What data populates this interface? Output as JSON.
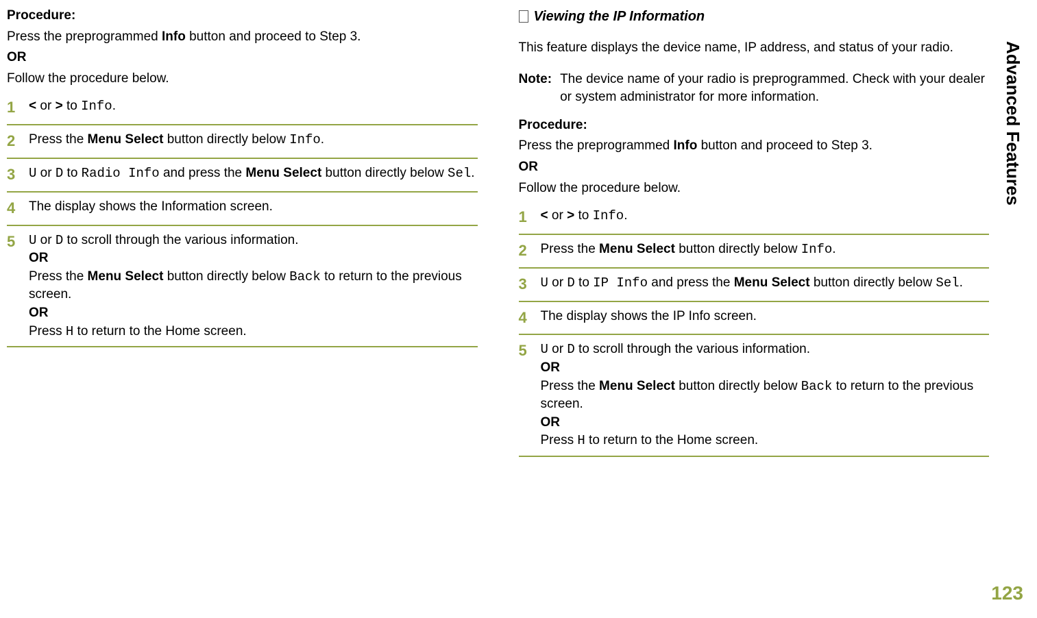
{
  "side_label": "Advanced Features",
  "page_number": "123",
  "left": {
    "procedure_label": "Procedure:",
    "intro_l1a": "Press the preprogrammed ",
    "intro_l1b": "Info",
    "intro_l1c": " button and proceed to Step 3.",
    "or": "OR",
    "intro_l2": "Follow the procedure below.",
    "s1_a": "<",
    "s1_b": " or ",
    "s1_c": ">",
    "s1_d": " to ",
    "s1_e": "Info",
    "s1_f": ".",
    "s2_a": "Press the ",
    "s2_b": "Menu Select",
    "s2_c": " button directly below ",
    "s2_d": "Info",
    "s2_e": ".",
    "s3_a": "U",
    "s3_b": " or ",
    "s3_c": "D",
    "s3_d": " to ",
    "s3_e": "Radio Info",
    "s3_f": " and press the ",
    "s3_g": "Menu Select",
    "s3_h": " button directly below ",
    "s3_i": "Sel",
    "s3_j": ".",
    "s4": "The display shows the Information screen.",
    "s5_a": "U",
    "s5_b": " or ",
    "s5_c": "D",
    "s5_d": " to scroll through the various information.",
    "s5_or": "OR",
    "s5_e": "Press the ",
    "s5_f": "Menu Select",
    "s5_g": " button directly below ",
    "s5_h": "Back",
    "s5_i": " to return to the previous screen.",
    "s5_or2": "OR",
    "s5_j": "Press ",
    "s5_k": "H",
    "s5_l": " to return to the Home screen."
  },
  "right": {
    "heading": "Viewing the IP Information",
    "intro": "This feature displays the device name, IP address, and status of your radio.",
    "note_label": "Note:",
    "note_body": "The device name of your radio is preprogrammed. Check with your dealer or system administrator for more information.",
    "procedure_label": "Procedure:",
    "intro_l1a": "Press the preprogrammed ",
    "intro_l1b": "Info",
    "intro_l1c": " button and proceed to Step 3.",
    "or": "OR",
    "intro_l2": "Follow the procedure below.",
    "s1_a": "<",
    "s1_b": " or ",
    "s1_c": ">",
    "s1_d": " to ",
    "s1_e": "Info",
    "s1_f": ".",
    "s2_a": "Press the ",
    "s2_b": "Menu Select",
    "s2_c": " button directly below ",
    "s2_d": "Info",
    "s2_e": ".",
    "s3_a": "U",
    "s3_b": " or ",
    "s3_c": "D",
    "s3_d": " to ",
    "s3_e": "IP Info",
    "s3_f": " and press the ",
    "s3_g": "Menu Select",
    "s3_h": " button directly below ",
    "s3_i": "Sel",
    "s3_j": ".",
    "s4": "The display shows the IP Info screen.",
    "s5_a": "U",
    "s5_b": " or ",
    "s5_c": "D",
    "s5_d": " to scroll through the various information.",
    "s5_or": "OR",
    "s5_e": "Press the ",
    "s5_f": "Menu Select",
    "s5_g": " button directly below ",
    "s5_h": "Back",
    "s5_i": " to return to the previous screen.",
    "s5_or2": "OR",
    "s5_j": "Press ",
    "s5_k": "H",
    "s5_l": " to return to the Home screen."
  },
  "nums": {
    "n1": "1",
    "n2": "2",
    "n3": "3",
    "n4": "4",
    "n5": "5"
  }
}
